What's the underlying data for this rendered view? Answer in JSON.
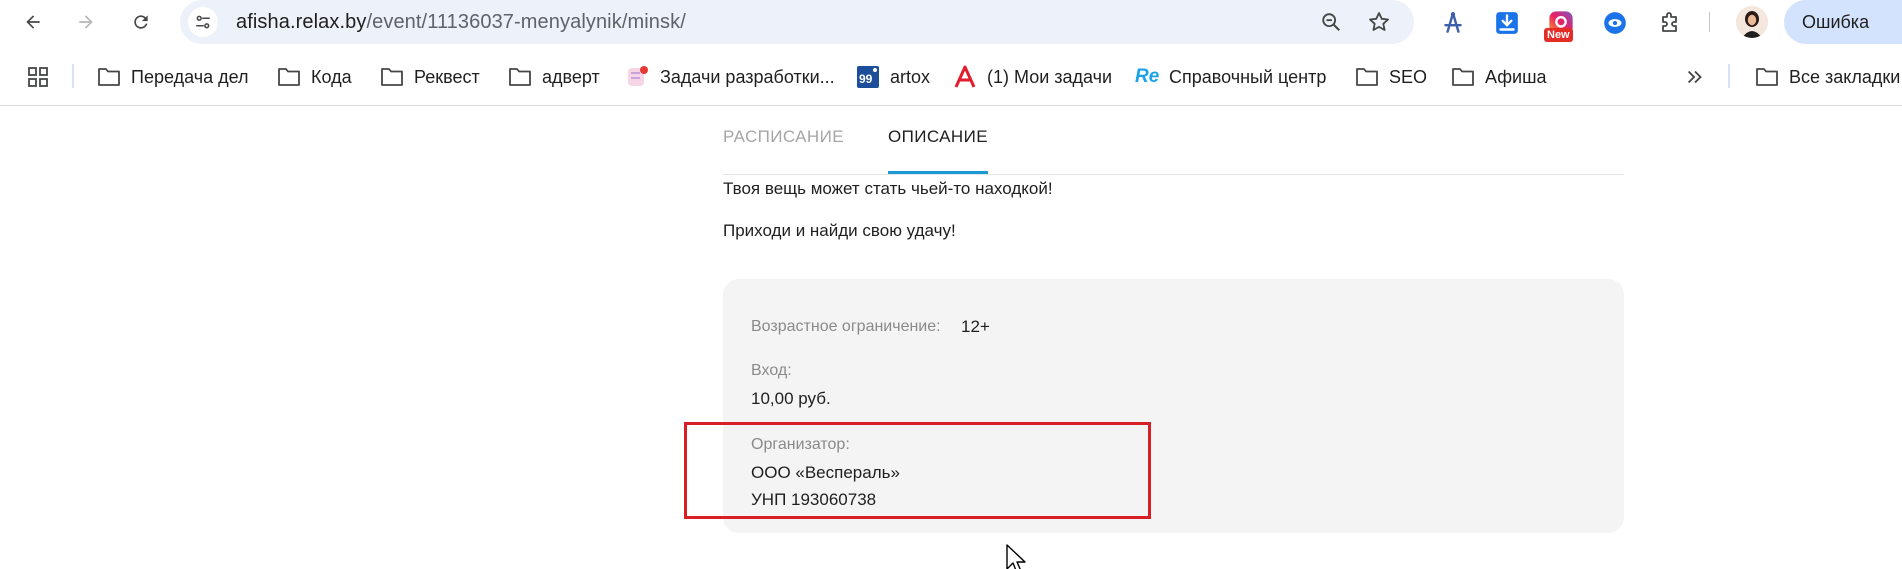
{
  "browser": {
    "url_host": "afisha.relax.by",
    "url_path": "/event/11136037-menyalynik/minsk/",
    "profile_button_label": "Ошибка",
    "extensions": [
      {
        "name": "extension-new-badge",
        "badge": "New"
      }
    ]
  },
  "bookmarks": {
    "items": [
      {
        "label": "Передача дел"
      },
      {
        "label": "Кода"
      },
      {
        "label": "Реквест"
      },
      {
        "label": "адверт"
      },
      {
        "label": "Задачи разработки..."
      },
      {
        "label": "artox"
      },
      {
        "label": "(1) Мои задачи"
      },
      {
        "label": "Справочный центр"
      },
      {
        "label": "SEO"
      },
      {
        "label": "Афиша"
      }
    ],
    "artox_icon_text": "99",
    "re_icon_text": "Re",
    "all_bookmarks_label": "Все закладки"
  },
  "page": {
    "tabs": [
      {
        "label": "РАСПИСАНИЕ",
        "active": false
      },
      {
        "label": "ОПИСАНИЕ",
        "active": true
      }
    ],
    "description": [
      "Твоя вещь может стать чьей-то находкой!",
      "Приходи и найди свою удачу!"
    ],
    "info": {
      "age_label": "Возрастное ограничение:",
      "age_value": "12+",
      "entry_label": "Вход:",
      "entry_value": "10,00 руб.",
      "organizer_label": "Организатор:",
      "organizer_name": "ООО «Веспераль»",
      "organizer_unp": "УНП 193060738"
    }
  },
  "colors": {
    "accent_tab": "#1c9ad6",
    "highlight_box": "#d71f26",
    "omnibox_bg": "#edf1f9",
    "profile_pill_bg": "#d3e3fd"
  }
}
